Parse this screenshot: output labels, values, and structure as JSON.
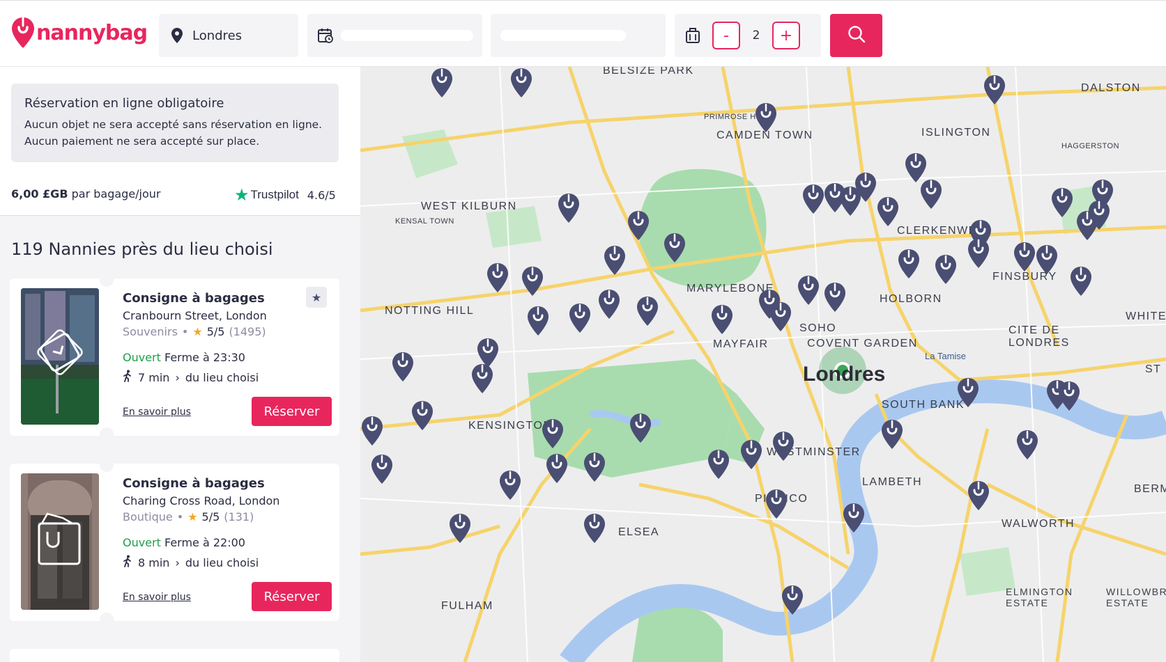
{
  "header": {
    "brand": "nannybag",
    "location_value": "Londres",
    "bag_count": "2",
    "minus_label": "-",
    "plus_label": "+"
  },
  "notice": {
    "title": "Réservation en ligne obligatoire",
    "line1": "Aucun objet ne sera accepté sans réservation en ligne.",
    "line2": "Aucun paiement ne sera accepté sur place."
  },
  "pricing": {
    "price": "6,00 £GB",
    "unit": "par bagage/jour",
    "trust_brand": "Trustpilot",
    "trust_score": "4.6/5"
  },
  "results": {
    "count_title": "119 Nannies près du lieu choisi",
    "cards": [
      {
        "title": "Consigne à bagages",
        "address": "Cranbourn Street, London",
        "category": "Souvenirs",
        "rating": "5/5",
        "reviews": "(1495)",
        "open": "Ouvert",
        "closes": "Ferme à 23:30",
        "walk_time": "7 min",
        "walk_label": "du lieu choisi",
        "more": "En savoir plus",
        "reserve": "Réserver"
      },
      {
        "title": "Consigne à bagages",
        "address": "Charing Cross Road, London",
        "category": "Boutique",
        "rating": "5/5",
        "reviews": "(131)",
        "open": "Ouvert",
        "closes": "Ferme à 22:00",
        "walk_time": "8 min",
        "walk_label": "du lieu choisi",
        "more": "En savoir plus",
        "reserve": "Réserver"
      }
    ]
  },
  "map": {
    "city_label": "Londres",
    "river_label": "La Tamise",
    "districts": [
      "BELSIZE PARK",
      "CAMDEN TOWN",
      "ISLINGTON",
      "DALSTON",
      "HAGGERSTON",
      "WEST KILBURN",
      "KENSAL TOWN",
      "CLERKENWELL",
      "FINSBURY",
      "MARYLEBONE",
      "HOLBORN",
      "NOTTING HILL",
      "SOHO",
      "MAYFAIR",
      "COVENT GARDEN",
      "CITE DE LONDRES",
      "SOUTH BANK",
      "KENSINGTON",
      "WESTMINSTER",
      "LAMBETH",
      "PIMLICO",
      "WALWORTH",
      "ELSEA",
      "FULHAM",
      "ELMINGTON ESTATE",
      "WILLOWBROOK ESTATE",
      "PRIMROSE HILL",
      "BERMO",
      "WHITEC",
      "ST K"
    ],
    "colors": {
      "pin": "#4a4e72",
      "park": "#a8dcae",
      "water": "#a9c8f0",
      "road": "#f6d36b",
      "accent": "#e8265e"
    }
  }
}
